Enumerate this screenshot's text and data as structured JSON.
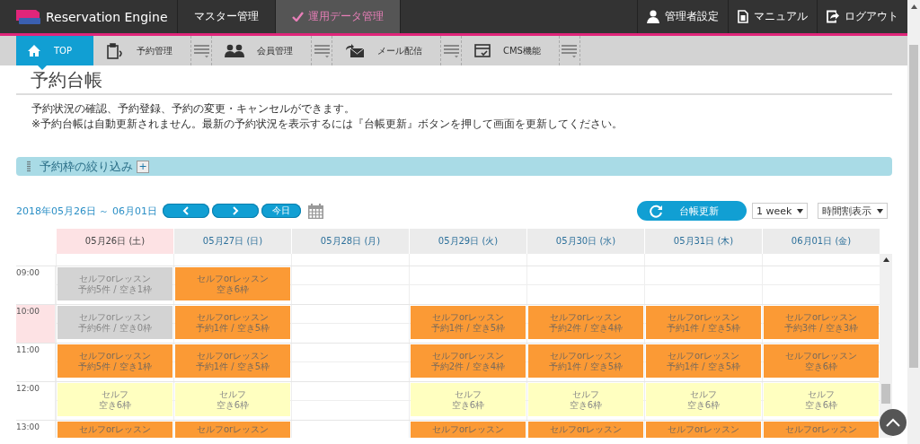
{
  "header": {
    "app_name": "Reservation Engine",
    "modes": [
      {
        "label": "マスター管理",
        "selected": false
      },
      {
        "label": "運用データ管理",
        "selected": true
      }
    ],
    "links": [
      {
        "label": "管理者設定"
      },
      {
        "label": "マニュアル"
      },
      {
        "label": "ログアウト"
      }
    ]
  },
  "nav": [
    {
      "label": "TOP",
      "selected": true,
      "has_menu": false
    },
    {
      "label": "予約管理",
      "selected": false,
      "has_menu": true
    },
    {
      "label": "会員管理",
      "selected": false,
      "has_menu": true
    },
    {
      "label": "メール配信",
      "selected": false,
      "has_menu": true
    },
    {
      "label": "CMS機能",
      "selected": false,
      "has_menu": true
    }
  ],
  "page": {
    "title": "予約台帳",
    "description": [
      "予約状況の確認、予約登録、予約の変更・キャンセルができます。",
      "※予約台帳は自動更新されません。最新の予約状況を表示するには『台帳更新』ボタンを押して画面を更新してください。"
    ]
  },
  "filter": {
    "label": "予約枠の絞り込み",
    "expand_label": "+"
  },
  "toolbar": {
    "range": "2018年05月26日 ～ 06月01日",
    "today_button": "今日",
    "refresh_button": "台帳更新",
    "period": "1 week",
    "view": "時間割表示"
  },
  "calendar": {
    "days": [
      {
        "label": "05月26日 (土)",
        "selected": true
      },
      {
        "label": "05月27日 (日)",
        "selected": false
      },
      {
        "label": "05月28日 (月)",
        "selected": false
      },
      {
        "label": "05月29日 (火)",
        "selected": false
      },
      {
        "label": "05月30日 (水)",
        "selected": false
      },
      {
        "label": "05月31日 (木)",
        "selected": false
      },
      {
        "label": "06月01日 (金)",
        "selected": false
      }
    ],
    "rows": [
      {
        "time": "09:00",
        "current": false,
        "slots": [
          {
            "kind": "full",
            "title": "セルフorレッスン",
            "status": "予約5件 / 空き1枠"
          },
          {
            "kind": "lesson",
            "title": "セルフorレッスン",
            "status": "空き6枠"
          },
          {
            "kind": "empty"
          },
          {
            "kind": "empty"
          },
          {
            "kind": "empty"
          },
          {
            "kind": "empty"
          },
          {
            "kind": "empty"
          }
        ]
      },
      {
        "time": "10:00",
        "current": true,
        "slots": [
          {
            "kind": "full",
            "title": "セルフorレッスン",
            "status": "予約6件 / 空き0枠"
          },
          {
            "kind": "lesson",
            "title": "セルフorレッスン",
            "status": "予約1件 / 空き5枠"
          },
          {
            "kind": "empty"
          },
          {
            "kind": "lesson",
            "title": "セルフorレッスン",
            "status": "予約1件 / 空き5枠"
          },
          {
            "kind": "lesson",
            "title": "セルフorレッスン",
            "status": "予約2件 / 空き4枠"
          },
          {
            "kind": "lesson",
            "title": "セルフorレッスン",
            "status": "予約1件 / 空き5枠"
          },
          {
            "kind": "lesson",
            "title": "セルフorレッスン",
            "status": "予約3件 / 空き3枠"
          }
        ]
      },
      {
        "time": "11:00",
        "current": false,
        "slots": [
          {
            "kind": "lesson",
            "title": "セルフorレッスン",
            "status": "予約5件 / 空き1枠"
          },
          {
            "kind": "lesson",
            "title": "セルフorレッスン",
            "status": "予約1件 / 空き5枠"
          },
          {
            "kind": "empty"
          },
          {
            "kind": "lesson",
            "title": "セルフorレッスン",
            "status": "予約2件 / 空き4枠"
          },
          {
            "kind": "lesson",
            "title": "セルフorレッスン",
            "status": "予約1件 / 空き5枠"
          },
          {
            "kind": "lesson",
            "title": "セルフorレッスン",
            "status": "予約1件 / 空き5枠"
          },
          {
            "kind": "lesson",
            "title": "セルフorレッスン",
            "status": "空き6枠"
          }
        ]
      },
      {
        "time": "12:00",
        "current": false,
        "slots": [
          {
            "kind": "self",
            "title": "セルフ",
            "status": "空き6枠"
          },
          {
            "kind": "self",
            "title": "セルフ",
            "status": "空き6枠"
          },
          {
            "kind": "empty"
          },
          {
            "kind": "self",
            "title": "セルフ",
            "status": "空き6枠"
          },
          {
            "kind": "self",
            "title": "セルフ",
            "status": "空き6枠"
          },
          {
            "kind": "self",
            "title": "セルフ",
            "status": "空き6枠"
          },
          {
            "kind": "self",
            "title": "セルフ",
            "status": "空き6枠"
          }
        ]
      },
      {
        "time": "13:00",
        "current": false,
        "slots": [
          {
            "kind": "lesson",
            "title": "セルフorレッスン"
          },
          {
            "kind": "lesson",
            "title": "セルフorレッスン"
          },
          {
            "kind": "empty"
          },
          {
            "kind": "lesson",
            "title": "セルフorレッスン"
          },
          {
            "kind": "lesson",
            "title": "セルフorレッスン"
          },
          {
            "kind": "lesson",
            "title": "セルフorレッスン"
          },
          {
            "kind": "lesson",
            "title": "セルフorレッスン"
          }
        ]
      }
    ]
  }
}
